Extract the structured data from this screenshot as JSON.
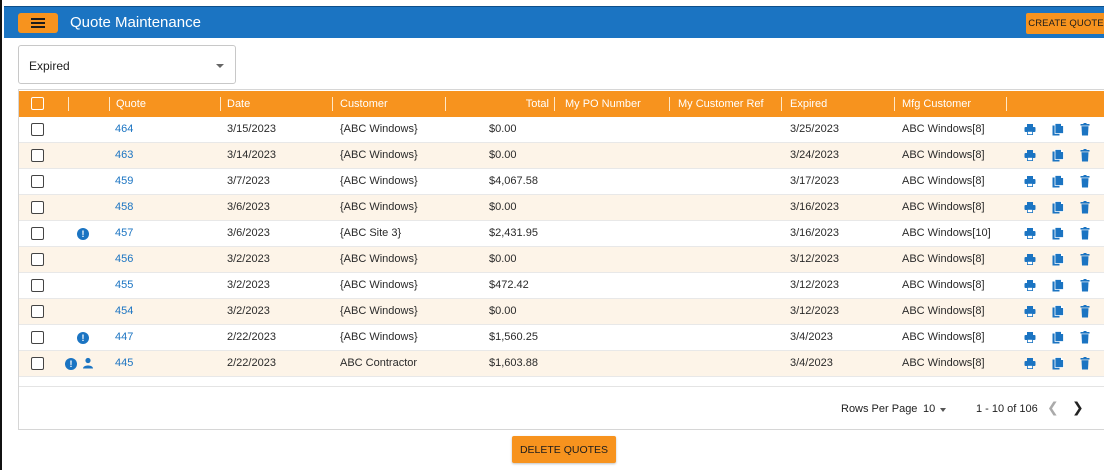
{
  "app": {
    "title": "Quote Maintenance",
    "create_label": "CREATE QUOTE",
    "brand_color": "#1b74c2",
    "accent_color": "#f7931e"
  },
  "filter": {
    "selected": "Expired"
  },
  "table": {
    "columns": [
      "Quote",
      "Date",
      "Customer",
      "Total",
      "My PO Number",
      "My Customer Ref",
      "Expired",
      "Mfg Customer"
    ],
    "rows": [
      {
        "quote": "464",
        "date": "3/15/2023",
        "customer": "{ABC Windows}",
        "total": "$0.00",
        "po": "",
        "ref": "",
        "expired": "3/25/2023",
        "mfg": "ABC Windows[8]",
        "warning": false,
        "person": false
      },
      {
        "quote": "463",
        "date": "3/14/2023",
        "customer": "{ABC Windows}",
        "total": "$0.00",
        "po": "",
        "ref": "",
        "expired": "3/24/2023",
        "mfg": "ABC Windows[8]",
        "warning": false,
        "person": false
      },
      {
        "quote": "459",
        "date": "3/7/2023",
        "customer": "{ABC Windows}",
        "total": "$4,067.58",
        "po": "",
        "ref": "",
        "expired": "3/17/2023",
        "mfg": "ABC Windows[8]",
        "warning": false,
        "person": false
      },
      {
        "quote": "458",
        "date": "3/6/2023",
        "customer": "{ABC Windows}",
        "total": "$0.00",
        "po": "",
        "ref": "",
        "expired": "3/16/2023",
        "mfg": "ABC Windows[8]",
        "warning": false,
        "person": false
      },
      {
        "quote": "457",
        "date": "3/6/2023",
        "customer": "{ABC Site 3}",
        "total": "$2,431.95",
        "po": "",
        "ref": "",
        "expired": "3/16/2023",
        "mfg": "ABC Windows[10]",
        "warning": true,
        "person": false
      },
      {
        "quote": "456",
        "date": "3/2/2023",
        "customer": "{ABC Windows}",
        "total": "$0.00",
        "po": "",
        "ref": "",
        "expired": "3/12/2023",
        "mfg": "ABC Windows[8]",
        "warning": false,
        "person": false
      },
      {
        "quote": "455",
        "date": "3/2/2023",
        "customer": "{ABC Windows}",
        "total": "$472.42",
        "po": "",
        "ref": "",
        "expired": "3/12/2023",
        "mfg": "ABC Windows[8]",
        "warning": false,
        "person": false
      },
      {
        "quote": "454",
        "date": "3/2/2023",
        "customer": "{ABC Windows}",
        "total": "$0.00",
        "po": "",
        "ref": "",
        "expired": "3/12/2023",
        "mfg": "ABC Windows[8]",
        "warning": false,
        "person": false
      },
      {
        "quote": "447",
        "date": "2/22/2023",
        "customer": "{ABC Windows}",
        "total": "$1,560.25",
        "po": "",
        "ref": "",
        "expired": "3/4/2023",
        "mfg": "ABC Windows[8]",
        "warning": true,
        "person": false
      },
      {
        "quote": "445",
        "date": "2/22/2023",
        "customer": "ABC Contractor",
        "total": "$1,603.88",
        "po": "",
        "ref": "",
        "expired": "3/4/2023",
        "mfg": "ABC Windows[8]",
        "warning": true,
        "person": true
      }
    ],
    "row_icons": [
      "print-icon",
      "copy-icon",
      "delete-icon"
    ]
  },
  "pagination": {
    "rows_per_page_label": "Rows Per Page",
    "rows_per_page": "10",
    "range": "1 - 10 of 106"
  },
  "actions": {
    "delete_label": "DELETE QUOTES"
  }
}
